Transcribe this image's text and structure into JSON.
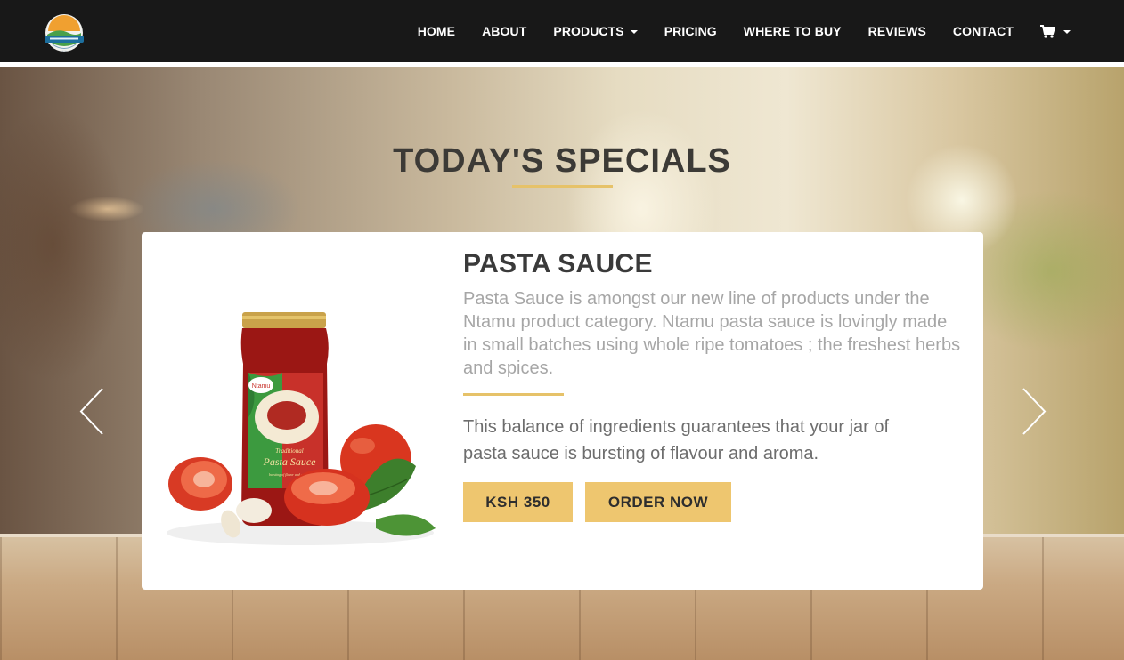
{
  "nav": {
    "items": [
      {
        "label": "HOME",
        "dropdown": false
      },
      {
        "label": "ABOUT",
        "dropdown": false
      },
      {
        "label": "PRODUCTS",
        "dropdown": true
      },
      {
        "label": "PRICING",
        "dropdown": false
      },
      {
        "label": "WHERE TO BUY",
        "dropdown": false
      },
      {
        "label": "REVIEWS",
        "dropdown": false
      },
      {
        "label": "CONTACT",
        "dropdown": false
      }
    ],
    "cart_icon": "shopping-cart-icon"
  },
  "hero": {
    "title": "TODAY'S SPECIALS"
  },
  "product": {
    "name": "PASTA SAUCE",
    "description": "Pasta Sauce is amongst our new line of products under the Ntamu product category. Ntamu pasta sauce is lovingly made in small batches using whole ripe tomatoes ; the freshest herbs and spices.",
    "description2": "This balance of ingredients guarantees that your jar of pasta sauce is bursting of flavour and aroma.",
    "price_label": "KSH 350",
    "order_label": "ORDER NOW",
    "jar_label": {
      "brand": "Ntamu",
      "line1": "Traditional",
      "line2": "Pasta Sauce",
      "tagline": "bursting of flavor and aroma"
    }
  },
  "colors": {
    "navbar": "#181818",
    "accent": "#eec66f",
    "title": "#3c3a36"
  }
}
